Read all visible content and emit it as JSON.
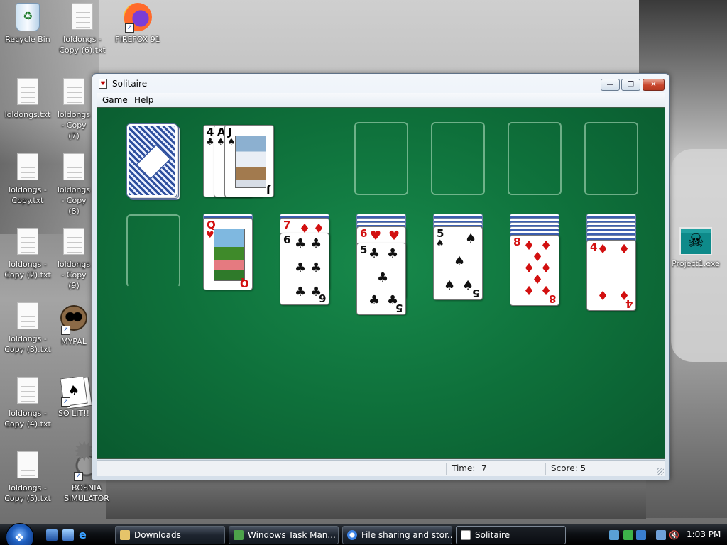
{
  "desktop": {
    "icons": [
      {
        "label": "Recycle Bin"
      },
      {
        "label": "loldongs - Copy (6).txt"
      },
      {
        "label": "FIREFOX 91"
      },
      {
        "label": "loldongs.txt"
      },
      {
        "label": "loldongs - Copy (7)"
      },
      {
        "label": "loldongs - Copy.txt"
      },
      {
        "label": "loldongs - Copy (8)"
      },
      {
        "label": "loldongs - Copy (2).txt"
      },
      {
        "label": "loldongs - Copy (9)"
      },
      {
        "label": "loldongs - Copy (3).txt"
      },
      {
        "label": "MYPAL"
      },
      {
        "label": "loldongs - Copy (4).txt"
      },
      {
        "label": "SO LIT!!"
      },
      {
        "label": "loldongs - Copy (5).txt"
      },
      {
        "label": "BOSNIA SIMULATOR"
      },
      {
        "label": "Project1.exe"
      }
    ]
  },
  "window": {
    "title": "Solitaire",
    "menu": {
      "game": "Game",
      "help": "Help"
    },
    "controls": {
      "minimize": "—",
      "maximize": "❐",
      "close": "✕"
    }
  },
  "game": {
    "stock": {
      "state": "face-down"
    },
    "waste": [
      {
        "rank": "4",
        "suit": "♣",
        "color": "black"
      },
      {
        "rank": "A",
        "suit": "♠",
        "color": "black"
      },
      {
        "rank": "J",
        "suit": "♠",
        "color": "black"
      }
    ],
    "foundations_filled": 0,
    "tableau": [
      {
        "hidden": 0,
        "cards": []
      },
      {
        "hidden": 1,
        "cards": [
          {
            "rank": "Q",
            "suit": "♥",
            "color": "red"
          }
        ]
      },
      {
        "hidden": 1,
        "cards": [
          {
            "rank": "7",
            "suit": "♦",
            "color": "red"
          },
          {
            "rank": "6",
            "suit": "♣",
            "color": "black"
          }
        ]
      },
      {
        "hidden": 3,
        "cards": [
          {
            "rank": "6",
            "suit": "♥",
            "color": "red"
          },
          {
            "rank": "5",
            "suit": "♣",
            "color": "black"
          }
        ]
      },
      {
        "hidden": 3,
        "cards": [
          {
            "rank": "5",
            "suit": "♠",
            "color": "black"
          }
        ]
      },
      {
        "hidden": 5,
        "cards": [
          {
            "rank": "8",
            "suit": "♦",
            "color": "red"
          }
        ]
      },
      {
        "hidden": 6,
        "cards": [
          {
            "rank": "4",
            "suit": "♦",
            "color": "red"
          }
        ]
      }
    ]
  },
  "status": {
    "time_label": "Time:",
    "time_value": "7",
    "score": "Score: 5"
  },
  "taskbar": {
    "start_glyph": "❖",
    "tasks": [
      {
        "label": "Downloads"
      },
      {
        "label": "Windows Task Man..."
      },
      {
        "label": "File sharing and stor..."
      },
      {
        "label": "Solitaire"
      }
    ],
    "clock": "1:03 PM"
  }
}
